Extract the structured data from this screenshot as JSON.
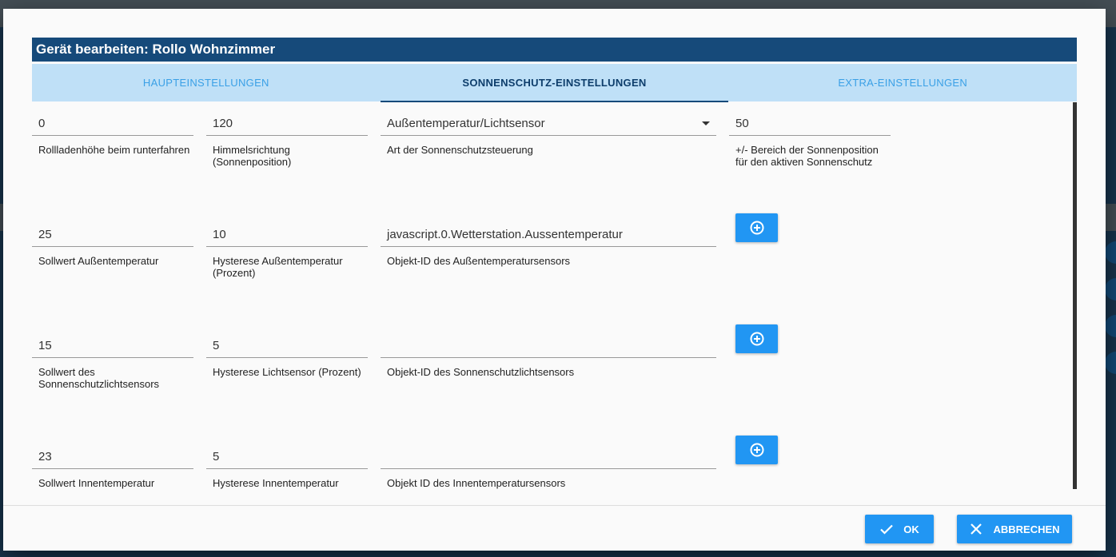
{
  "dialog": {
    "title": "Gerät bearbeiten: Rollo Wohnzimmer",
    "tabs": [
      {
        "label": "HAUPTEINSTELLUNGEN",
        "active": false
      },
      {
        "label": "SONNENSCHUTZ-EINSTELLUNGEN",
        "active": true
      },
      {
        "label": "EXTRA-EINSTELLUNGEN",
        "active": false
      }
    ],
    "rows": [
      {
        "height": {
          "value": "0",
          "label": "Rollladenhöhe beim runterfahren"
        },
        "direction": {
          "value": "120",
          "label": "Himmelsrichtung (Sonnenposition)"
        },
        "mode": {
          "value": "Außentemperatur/Lichtsensor",
          "label": "Art der Sonnenschutzsteuerung"
        },
        "range": {
          "value": "50",
          "label": "+/- Bereich der Sonnenposition für den aktiven Sonnenschutz"
        }
      },
      {
        "setpoint": {
          "value": "25",
          "label": "Sollwert Außentemperatur"
        },
        "hysteresis": {
          "value": "10",
          "label": "Hysterese Außentemperatur (Prozent)"
        },
        "object_id": {
          "value": "javascript.0.Wetterstation.Aussentemperatur",
          "label": "Objekt-ID des Außentemperatursensors"
        }
      },
      {
        "setpoint": {
          "value": "15",
          "label": "Sollwert des Sonnenschutzlichtsensors"
        },
        "hysteresis": {
          "value": "5",
          "label": "Hysterese Lichtsensor (Prozent)"
        },
        "object_id": {
          "value": "",
          "label": "Objekt-ID des Sonnenschutzlichtsensors"
        }
      },
      {
        "setpoint": {
          "value": "23",
          "label": "Sollwert Innentemperatur"
        },
        "hysteresis": {
          "value": "5",
          "label": "Hysterese Innentemperatur"
        },
        "object_id": {
          "value": "",
          "label": "Objekt ID des Innentemperatursensors"
        }
      }
    ],
    "add_icon": "plus-circle-icon",
    "buttons": {
      "ok": "OK",
      "cancel": "ABBRECHEN"
    }
  },
  "colors": {
    "title_bg": "#164a7a",
    "tab_bg": "#bfe0f7",
    "accent": "#2196f3"
  }
}
